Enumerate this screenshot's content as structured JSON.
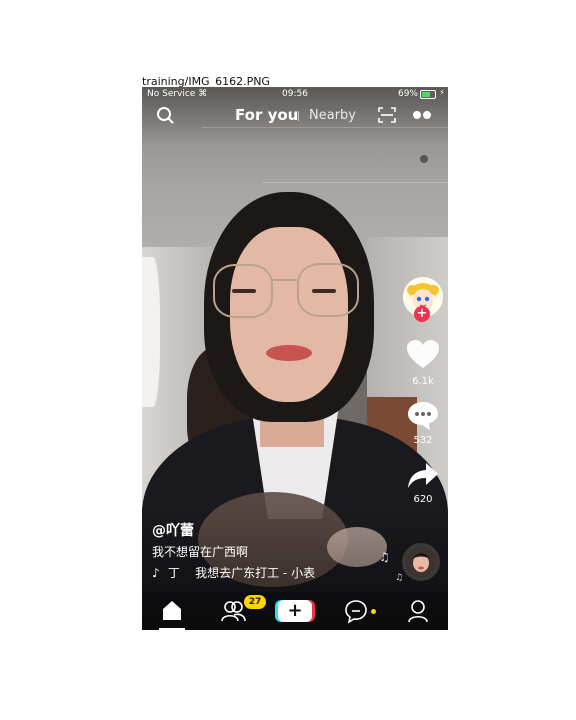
{
  "file_label": "training/IMG_6162.PNG",
  "status_bar": {
    "carrier": "No Service",
    "time": "09:56",
    "battery_percent": "69%",
    "battery_level": 0.69
  },
  "top_nav": {
    "tabs": [
      "For you",
      "Nearby"
    ],
    "active_tab": "For you"
  },
  "right_rail": {
    "likes": "6.1k",
    "comments": "532",
    "shares": "620"
  },
  "caption": {
    "username": "@吖蕾",
    "description": "我不想留在广西啊",
    "music": "我想去广东打工 - 小表"
  },
  "bottom_nav": {
    "friends_badge": "27",
    "items": [
      "home-icon",
      "friends-icon",
      "create-button",
      "messages-icon",
      "profile-icon"
    ]
  },
  "colors": {
    "accent_red": "#f0304f",
    "accent_cyan": "#27e2ec",
    "badge_yellow": "#ffd500",
    "battery_green": "#4cd964"
  }
}
